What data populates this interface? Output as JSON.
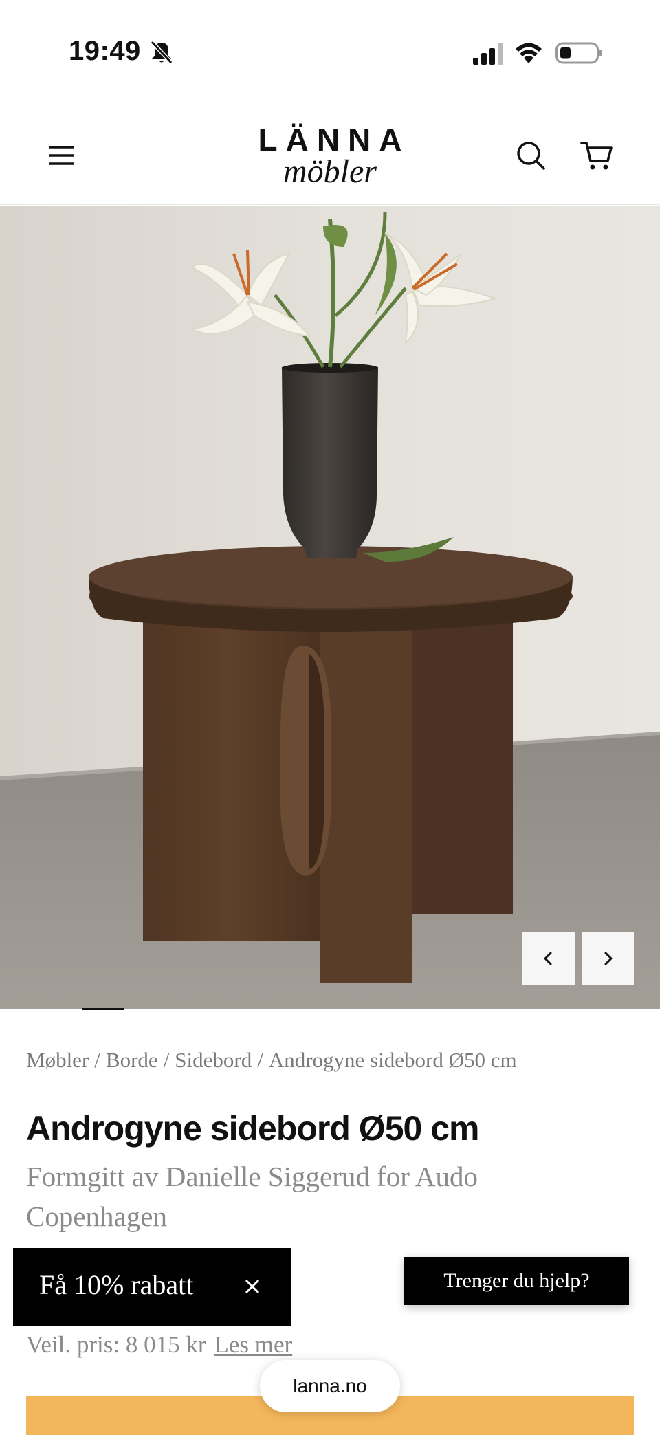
{
  "status_bar": {
    "time": "19:49",
    "icons": [
      "bell-slash-icon",
      "cellular-signal-icon",
      "wifi-icon",
      "battery-icon"
    ]
  },
  "header": {
    "logo_line1": "LÄNNA",
    "logo_line2": "möbler",
    "icons": [
      "hamburger-menu-icon",
      "search-icon",
      "shopping-cart-icon"
    ]
  },
  "gallery": {
    "prev_icon": "chevron-left-icon",
    "next_icon": "chevron-right-icon"
  },
  "breadcrumb": {
    "items": [
      "Møbler",
      "Borde",
      "Sidebord",
      "Androgyne sidebord Ø50 cm"
    ],
    "separator": "/"
  },
  "product": {
    "title": "Androgyne sidebord Ø50 cm",
    "subtitle": "Formgitt av Danielle Siggerud for Audo Copenhagen",
    "price_text": "Veil. pris: 8 015 kr",
    "more_link": "Les mer"
  },
  "discount_popup": {
    "label": "Få 10% rabatt",
    "close_icon": "close-icon"
  },
  "help_button": {
    "label": "Trenger du hjelp?"
  },
  "browser": {
    "url": "lanna.no"
  },
  "colors": {
    "accent": "#f4b65a",
    "text_muted": "#8a8a8a",
    "popup_bg": "#000000"
  }
}
